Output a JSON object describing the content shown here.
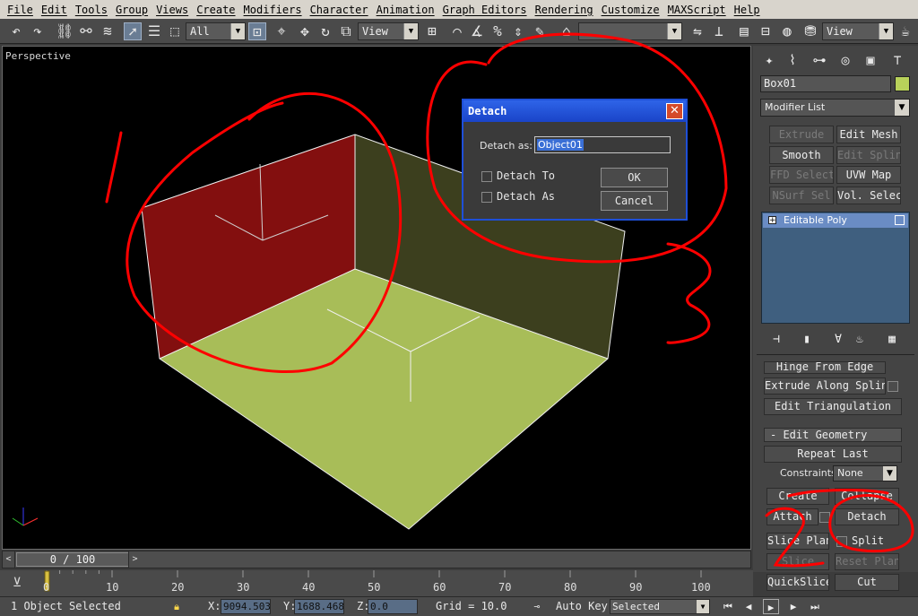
{
  "menu": [
    "File",
    "Edit",
    "Tools",
    "Group",
    "Views",
    "Create",
    "Modifiers",
    "Character",
    "Animation",
    "Graph Editors",
    "Rendering",
    "Customize",
    "MAXScript",
    "Help"
  ],
  "toolbar": {
    "selection_filter": "All",
    "ref_coord": "View",
    "named_set": "",
    "view_right": "View"
  },
  "viewport": {
    "label": "Perspective"
  },
  "dialog": {
    "title": "Detach",
    "close_glyph": "✕",
    "detach_as_label": "Detach as:",
    "detach_as_value": "Object01",
    "detach_to_label": "Detach To",
    "detach_as_clone_label": "Detach As",
    "ok_label": "OK",
    "cancel_label": "Cancel"
  },
  "command_panel": {
    "object_name": "Box01",
    "object_color": "#b8d15a",
    "modifier_list": "Modifier List",
    "modifier_buttons": [
      {
        "label": "Extrude",
        "dim": true
      },
      {
        "label": "Edit Mesh",
        "dim": false
      },
      {
        "label": "Smooth",
        "dim": false
      },
      {
        "label": "Edit Spline",
        "dim": true
      },
      {
        "label": "FFD Select",
        "dim": true
      },
      {
        "label": "UVW Map",
        "dim": false
      },
      {
        "label": "NSurf Sel",
        "dim": true
      },
      {
        "label": "Vol. Select",
        "dim": false
      }
    ],
    "stack_item": "Editable Poly",
    "rollout": {
      "hinge_from_edge": "Hinge From Edge",
      "extrude_along_spline": "Extrude Along Spline",
      "edit_triangulation": "Edit Triangulation",
      "edit_geometry_header": "-     Edit Geometry",
      "repeat_last": "Repeat Last",
      "constraints_label": "Constraints:",
      "constraints_value": "None",
      "create": "Create",
      "collapse": "Collapse",
      "attach": "Attach",
      "detach": "Detach",
      "slice_plane": "Slice Plane",
      "split": "Split",
      "slice": "Slice",
      "reset_plane": "Reset Plane",
      "quickslice": "QuickSlice",
      "cut": "Cut"
    }
  },
  "time_slider": {
    "value": "0 / 100",
    "left_arrow": "<",
    "right_arrow": ">"
  },
  "timeline_ticks": [
    "0",
    "10",
    "20",
    "30",
    "40",
    "50",
    "60",
    "70",
    "80",
    "90",
    "100"
  ],
  "status": {
    "selection": "1 Object Selected",
    "x_label": "X:",
    "x_value": "9094.503",
    "y_label": "Y:",
    "y_value": "1688.468",
    "z_label": "Z:",
    "z_value": "0.0",
    "grid": "Grid = 10.0",
    "auto_key": "Auto Key",
    "key_filter": "Selected"
  }
}
